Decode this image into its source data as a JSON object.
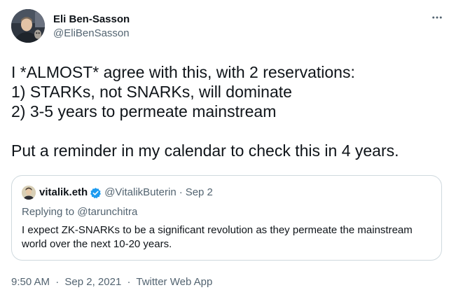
{
  "author": {
    "name": "Eli Ben-Sasson",
    "handle": "@EliBenSasson"
  },
  "tweet": {
    "text": "I *ALMOST* agree with this, with 2 reservations:\n1) STARKs, not SNARKs, will dominate\n2) 3-5 years to permeate mainstream\n\nPut a reminder in my calendar to check this in 4 years."
  },
  "quoted_tweet": {
    "name": "vitalik.eth",
    "handle": "@VitalikButerin",
    "separator": "·",
    "date": "Sep 2",
    "replying_prefix": "Replying to",
    "replying_to": "@tarunchitra",
    "text": "I expect ZK-SNARKs to be a significant revolution as they permeate the mainstream world over the next 10-20 years."
  },
  "meta": {
    "time": "9:50 AM",
    "separator": "·",
    "date": "Sep 2, 2021",
    "app": "Twitter Web App"
  },
  "icons": {
    "more": "more-horizontal-icon",
    "verified": "verified-badge-icon"
  },
  "colors": {
    "text_primary": "#0f1419",
    "text_secondary": "#536471",
    "border": "#cfd9de",
    "verified_blue": "#1d9bf0"
  }
}
